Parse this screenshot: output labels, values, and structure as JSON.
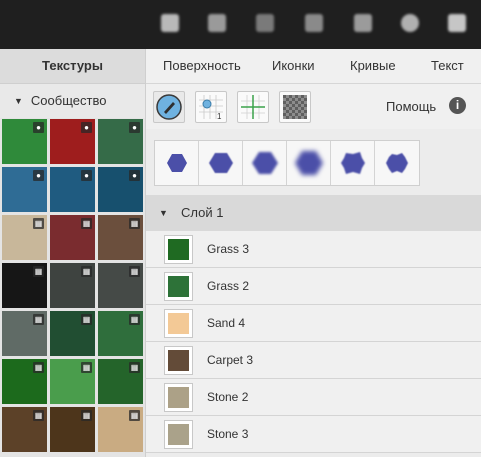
{
  "toolbar_icons": [
    "text-tool-icon",
    "bell-icon",
    "grid-icon",
    "tag-icon",
    "crop-icon",
    "gear-icon",
    "window-icon"
  ],
  "left_panel": {
    "title": "Текстуры",
    "group": "Сообщество",
    "swatches": [
      {
        "color": "#2f8a3a",
        "badge": "drop"
      },
      {
        "color": "#9e1d1d",
        "badge": "drop"
      },
      {
        "color": "#356b48",
        "badge": "drop"
      },
      {
        "color": "#2f6c95",
        "badge": "drop"
      },
      {
        "color": "#1f5b80",
        "badge": "drop"
      },
      {
        "color": "#17506e",
        "badge": "drop"
      },
      {
        "color": "#c8b79a",
        "badge": "grid"
      },
      {
        "color": "#7a2c2f",
        "badge": "grid"
      },
      {
        "color": "#6b4f3d",
        "badge": "grid"
      },
      {
        "color": "#161616",
        "badge": "grid"
      },
      {
        "color": "#3e4340",
        "badge": "grid"
      },
      {
        "color": "#454a47",
        "badge": "grid"
      },
      {
        "color": "#606b66",
        "badge": "grid"
      },
      {
        "color": "#214e32",
        "badge": "grid"
      },
      {
        "color": "#2f6e3c",
        "badge": "grid"
      },
      {
        "color": "#1c6a1c",
        "badge": "grid"
      },
      {
        "color": "#4a9d4c",
        "badge": "grid"
      },
      {
        "color": "#24642a",
        "badge": "grid"
      },
      {
        "color": "#5c4128",
        "badge": "grid"
      },
      {
        "color": "#4d351b",
        "badge": "grid"
      },
      {
        "color": "#c9ab82",
        "badge": "grid"
      }
    ]
  },
  "tabs": [
    "Поверхность",
    "Иконки",
    "Кривые",
    "Текст"
  ],
  "tools": [
    "brush-tool-icon",
    "grid-snap-icon",
    "crosshair-grid-icon",
    "transparency-icon"
  ],
  "help_label": "Помощь",
  "info_glyph": "i",
  "brushes": [
    "hard",
    "soft-1",
    "soft-2",
    "soft-3",
    "rough",
    "jagged"
  ],
  "brush_color": "#4b4fa8",
  "layer": {
    "name": "Слой 1",
    "items": [
      {
        "name": "Grass 3",
        "color": "#1f6a22"
      },
      {
        "name": "Grass 2",
        "color": "#2d7238"
      },
      {
        "name": "Sand 4",
        "color": "#f3c996"
      },
      {
        "name": "Carpet 3",
        "color": "#634b38"
      },
      {
        "name": "Stone 2",
        "color": "#aca187"
      },
      {
        "name": "Stone 3",
        "color": "#aaa28a"
      }
    ]
  }
}
